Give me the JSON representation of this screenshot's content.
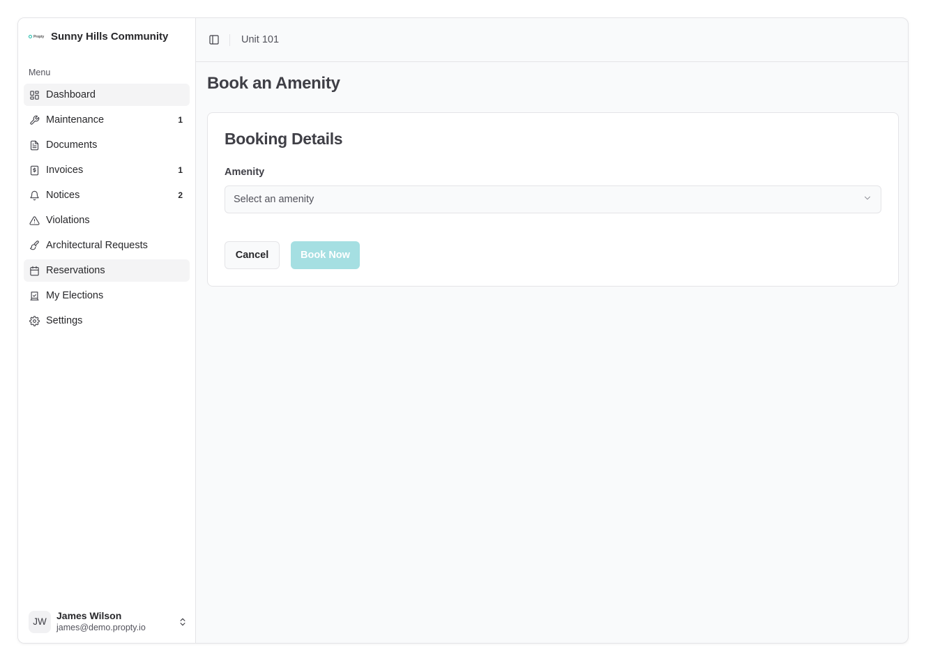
{
  "brand": {
    "logo_text": "Propty",
    "community_name": "Sunny Hills Community"
  },
  "sidebar": {
    "menu_label": "Menu",
    "items": [
      {
        "label": "Dashboard",
        "icon": "dashboard-icon",
        "badge": ""
      },
      {
        "label": "Maintenance",
        "icon": "wrench-icon",
        "badge": "1"
      },
      {
        "label": "Documents",
        "icon": "document-icon",
        "badge": ""
      },
      {
        "label": "Invoices",
        "icon": "invoice-icon",
        "badge": "1"
      },
      {
        "label": "Notices",
        "icon": "bell-icon",
        "badge": "2"
      },
      {
        "label": "Violations",
        "icon": "warning-icon",
        "badge": ""
      },
      {
        "label": "Architectural Requests",
        "icon": "paintbrush-icon",
        "badge": ""
      },
      {
        "label": "Reservations",
        "icon": "calendar-icon",
        "badge": ""
      },
      {
        "label": "My Elections",
        "icon": "ballot-icon",
        "badge": ""
      },
      {
        "label": "Settings",
        "icon": "gear-icon",
        "badge": ""
      }
    ],
    "active_item": "Reservations"
  },
  "user": {
    "initials": "JW",
    "name": "James Wilson",
    "email": "james@demo.propty.io"
  },
  "topbar": {
    "breadcrumb": "Unit 101"
  },
  "page": {
    "title": "Book an Amenity",
    "card_title": "Booking Details",
    "amenity_label": "Amenity",
    "amenity_placeholder": "Select an amenity",
    "cancel_label": "Cancel",
    "book_label": "Book Now"
  },
  "colors": {
    "accent_disabled": "#a5dfe2",
    "brand_teal": "#14b8a6"
  }
}
